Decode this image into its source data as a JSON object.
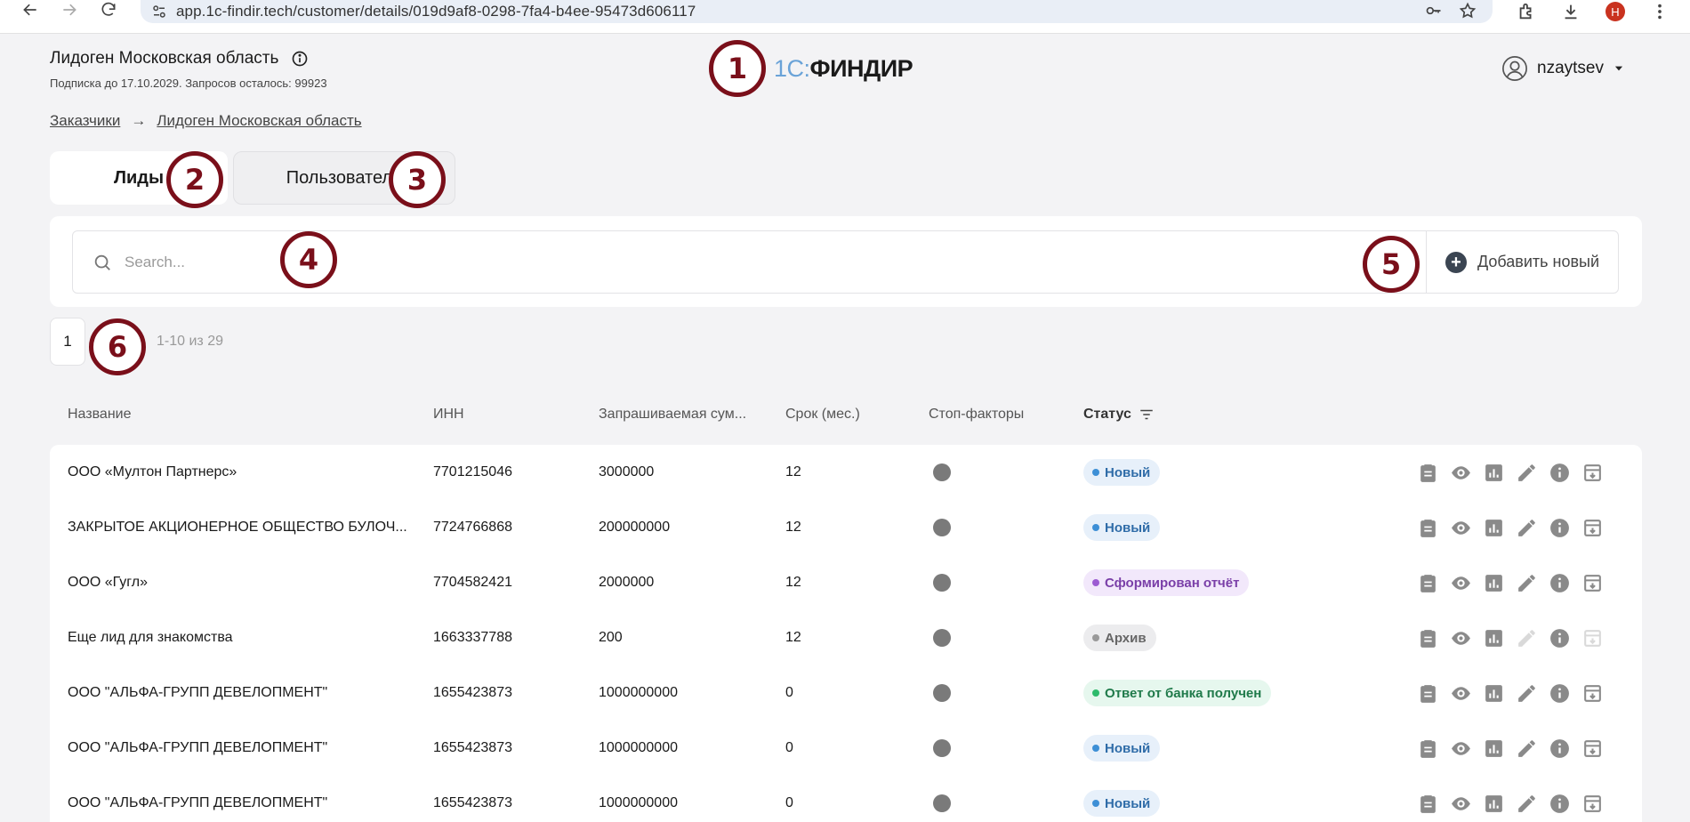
{
  "browser": {
    "url": "app.1c-findir.tech/customer/details/019d9af8-0298-7fa4-b4ee-95473d606117",
    "profile_initial": "Н"
  },
  "header": {
    "customer_title": "Лидоген Московская область",
    "subscription": "Подписка до 17.10.2029. Запросов осталось: 99923",
    "logo_one": "1С:",
    "logo_rest": "ФИНДИР",
    "username": "nzaytsev"
  },
  "breadcrumb": {
    "root": "Заказчики",
    "arrow": "→",
    "current": "Лидоген Московская область"
  },
  "tabs": [
    {
      "label": "Лиды",
      "active": true
    },
    {
      "label": "Пользователи",
      "active": false
    }
  ],
  "search": {
    "placeholder": "Search...",
    "value": ""
  },
  "toolbar": {
    "add_label": "Добавить новый"
  },
  "pagination": {
    "current_page": "1",
    "range": "1-10 из 29"
  },
  "table": {
    "columns": [
      "Название",
      "ИНН",
      "Запрашиваемая сум...",
      "Срок (мес.)",
      "Стоп-факторы",
      "Статус"
    ],
    "rows": [
      {
        "name": "ООО «Мултон Партнерс»",
        "inn": "7701215046",
        "amount": "3000000",
        "term": "12",
        "status": "Новый",
        "status_type": "new",
        "actions_disabled": false
      },
      {
        "name": "ЗАКРЫТОЕ АКЦИОНЕРНОЕ ОБЩЕСТВО БУЛОЧ...",
        "inn": "7724766868",
        "amount": "200000000",
        "term": "12",
        "status": "Новый",
        "status_type": "new",
        "actions_disabled": false
      },
      {
        "name": "ООО «Гугл»",
        "inn": "7704582421",
        "amount": "2000000",
        "term": "12",
        "status": "Сформирован отчёт",
        "status_type": "report",
        "actions_disabled": false
      },
      {
        "name": "Еще лид для знакомства",
        "inn": "1663337788",
        "amount": "200",
        "term": "12",
        "status": "Архив",
        "status_type": "archive",
        "actions_disabled": true
      },
      {
        "name": "ООО \"АЛЬФА-ГРУПП ДЕВЕЛОПМЕНТ\"",
        "inn": "1655423873",
        "amount": "1000000000",
        "term": "0",
        "status": "Ответ от банка получен",
        "status_type": "bank",
        "actions_disabled": false
      },
      {
        "name": "ООО \"АЛЬФА-ГРУПП ДЕВЕЛОПМЕНТ\"",
        "inn": "1655423873",
        "amount": "1000000000",
        "term": "0",
        "status": "Новый",
        "status_type": "new",
        "actions_disabled": false
      },
      {
        "name": "ООО \"АЛЬФА-ГРУПП ДЕВЕЛОПМЕНТ\"",
        "inn": "1655423873",
        "amount": "1000000000",
        "term": "0",
        "status": "Новый",
        "status_type": "new",
        "actions_disabled": false
      }
    ],
    "row_action_icons": [
      "clipboard-icon",
      "eye-icon",
      "chart-icon",
      "pencil-icon",
      "info-icon",
      "archive-icon"
    ]
  },
  "markers": [
    "1",
    "2",
    "3",
    "4",
    "5",
    "6"
  ],
  "colors": {
    "marker": "#7a0f1a",
    "logo_accent": "#6aa3d8",
    "badge_new": "#3d8fd6",
    "badge_report": "#9c5bd2",
    "badge_bank": "#2dba6b"
  }
}
